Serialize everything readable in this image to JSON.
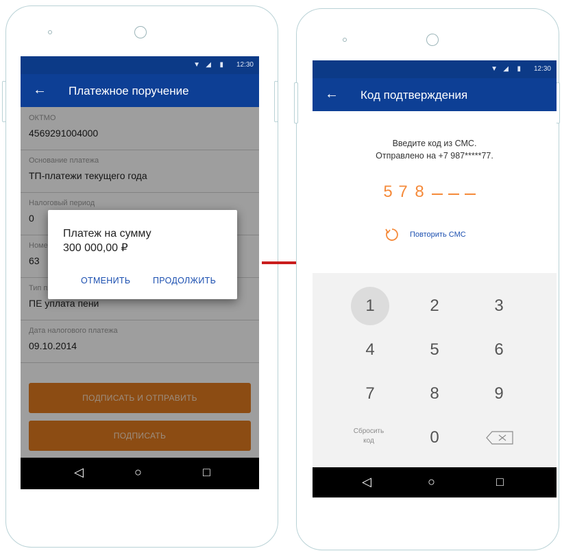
{
  "left_phone": {
    "status_time": "12:30",
    "appbar_title": "Платежное поручение",
    "fields": [
      {
        "label": "ОКТМО",
        "value": "4569291004000"
      },
      {
        "label": "Основание платежа",
        "value": "ТП-платежи текущего года"
      },
      {
        "label": "Налоговый период",
        "value": "0"
      },
      {
        "label": "Номер документа",
        "value": "63"
      },
      {
        "label": "Тип платежа",
        "value": "ПЕ уплата пени"
      },
      {
        "label": "Дата налогового платежа",
        "value": "09.10.2014"
      }
    ],
    "btn_sign_send": "ПОДПИСАТЬ И ОТПРАВИТЬ",
    "btn_sign": "ПОДПИСАТЬ",
    "dialog": {
      "line1": "Платеж на сумму",
      "line2": "300 000,00 ₽",
      "cancel": "ОТМЕНИТЬ",
      "continue": "ПРОДОЛЖИТЬ"
    }
  },
  "right_phone": {
    "status_time": "12:30",
    "appbar_title": "Код подтверждения",
    "info_line1": "Введите код из СМС.",
    "info_line2": "Отправлено на +7 987*****77.",
    "code_digits": [
      "5",
      "7",
      "8"
    ],
    "repeat_label": "Повторить СМС",
    "keys": [
      "1",
      "2",
      "3",
      "4",
      "5",
      "6",
      "7",
      "8",
      "9",
      "0"
    ],
    "reset_key": "Сбросить код"
  },
  "colors": {
    "appbar": "#0d3f95",
    "accent_orange": "#e37b1f",
    "code_orange": "#f58a3a",
    "arrow_red": "#c91d1d",
    "link_blue": "#1b4fb0"
  }
}
